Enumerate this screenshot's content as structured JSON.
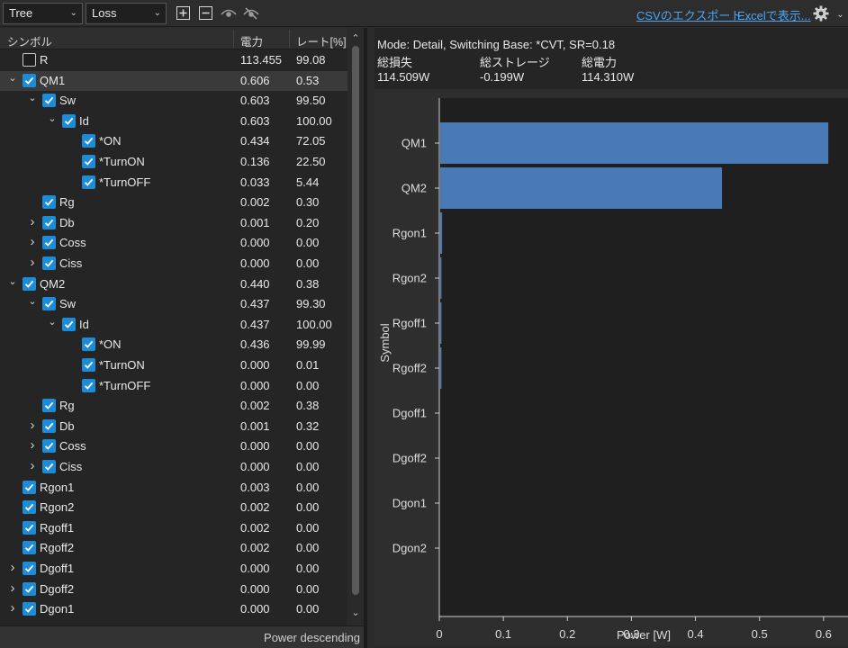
{
  "toolbar": {
    "view_combo": "Tree",
    "type_combo": "Loss",
    "csv_link": "CSVのエクスポート...",
    "excel_link": "Excelで表示..."
  },
  "table": {
    "headers": {
      "symbol": "シンボル",
      "power": "電力",
      "rate": "レート[%]"
    },
    "rows": [
      {
        "label": "R",
        "power": "113.455",
        "rate": "99.08",
        "depth": 0,
        "expander": "none",
        "checked": false,
        "selected": false
      },
      {
        "label": "QM1",
        "power": "0.606",
        "rate": "0.53",
        "depth": 0,
        "expander": "open",
        "checked": true,
        "selected": true
      },
      {
        "label": "Sw",
        "power": "0.603",
        "rate": "99.50",
        "depth": 1,
        "expander": "open",
        "checked": true,
        "selected": false
      },
      {
        "label": "Id",
        "power": "0.603",
        "rate": "100.00",
        "depth": 2,
        "expander": "open",
        "checked": true,
        "selected": false
      },
      {
        "label": "*ON",
        "power": "0.434",
        "rate": "72.05",
        "depth": 3,
        "expander": "none",
        "checked": true,
        "selected": false
      },
      {
        "label": "*TurnON",
        "power": "0.136",
        "rate": "22.50",
        "depth": 3,
        "expander": "none",
        "checked": true,
        "selected": false
      },
      {
        "label": "*TurnOFF",
        "power": "0.033",
        "rate": "5.44",
        "depth": 3,
        "expander": "none",
        "checked": true,
        "selected": false
      },
      {
        "label": "Rg",
        "power": "0.002",
        "rate": "0.30",
        "depth": 1,
        "expander": "none",
        "checked": true,
        "selected": false
      },
      {
        "label": "Db",
        "power": "0.001",
        "rate": "0.20",
        "depth": 1,
        "expander": "closed",
        "checked": true,
        "selected": false
      },
      {
        "label": "Coss",
        "power": "0.000",
        "rate": "0.00",
        "depth": 1,
        "expander": "closed",
        "checked": true,
        "selected": false
      },
      {
        "label": "Ciss",
        "power": "0.000",
        "rate": "0.00",
        "depth": 1,
        "expander": "closed",
        "checked": true,
        "selected": false
      },
      {
        "label": "QM2",
        "power": "0.440",
        "rate": "0.38",
        "depth": 0,
        "expander": "open",
        "checked": true,
        "selected": false
      },
      {
        "label": "Sw",
        "power": "0.437",
        "rate": "99.30",
        "depth": 1,
        "expander": "open",
        "checked": true,
        "selected": false
      },
      {
        "label": "Id",
        "power": "0.437",
        "rate": "100.00",
        "depth": 2,
        "expander": "open",
        "checked": true,
        "selected": false
      },
      {
        "label": "*ON",
        "power": "0.436",
        "rate": "99.99",
        "depth": 3,
        "expander": "none",
        "checked": true,
        "selected": false
      },
      {
        "label": "*TurnON",
        "power": "0.000",
        "rate": "0.01",
        "depth": 3,
        "expander": "none",
        "checked": true,
        "selected": false
      },
      {
        "label": "*TurnOFF",
        "power": "0.000",
        "rate": "0.00",
        "depth": 3,
        "expander": "none",
        "checked": true,
        "selected": false
      },
      {
        "label": "Rg",
        "power": "0.002",
        "rate": "0.38",
        "depth": 1,
        "expander": "none",
        "checked": true,
        "selected": false
      },
      {
        "label": "Db",
        "power": "0.001",
        "rate": "0.32",
        "depth": 1,
        "expander": "closed",
        "checked": true,
        "selected": false
      },
      {
        "label": "Coss",
        "power": "0.000",
        "rate": "0.00",
        "depth": 1,
        "expander": "closed",
        "checked": true,
        "selected": false
      },
      {
        "label": "Ciss",
        "power": "0.000",
        "rate": "0.00",
        "depth": 1,
        "expander": "closed",
        "checked": true,
        "selected": false
      },
      {
        "label": "Rgon1",
        "power": "0.003",
        "rate": "0.00",
        "depth": 0,
        "expander": "none",
        "checked": true,
        "selected": false
      },
      {
        "label": "Rgon2",
        "power": "0.002",
        "rate": "0.00",
        "depth": 0,
        "expander": "none",
        "checked": true,
        "selected": false
      },
      {
        "label": "Rgoff1",
        "power": "0.002",
        "rate": "0.00",
        "depth": 0,
        "expander": "none",
        "checked": true,
        "selected": false
      },
      {
        "label": "Rgoff2",
        "power": "0.002",
        "rate": "0.00",
        "depth": 0,
        "expander": "none",
        "checked": true,
        "selected": false
      },
      {
        "label": "Dgoff1",
        "power": "0.000",
        "rate": "0.00",
        "depth": 0,
        "expander": "closed",
        "checked": true,
        "selected": false
      },
      {
        "label": "Dgoff2",
        "power": "0.000",
        "rate": "0.00",
        "depth": 0,
        "expander": "closed",
        "checked": true,
        "selected": false
      },
      {
        "label": "Dgon1",
        "power": "0.000",
        "rate": "0.00",
        "depth": 0,
        "expander": "closed",
        "checked": true,
        "selected": false
      }
    ]
  },
  "status": {
    "sort_text": "Power descending"
  },
  "summary": {
    "mode": "Mode: Detail, Switching Base: *CVT, SR=0.18",
    "total_loss_label": "総損失",
    "total_storage_label": "総ストレージ",
    "total_power_label": "総電力",
    "total_loss_value": "114.509W",
    "total_storage_value": "-0.199W",
    "total_power_value": "114.310W"
  },
  "chart_data": {
    "type": "bar",
    "orientation": "horizontal",
    "categories": [
      "QM1",
      "QM2",
      "Rgon1",
      "Rgon2",
      "Rgoff1",
      "Rgoff2",
      "Dgoff1",
      "Dgoff2",
      "Dgon1",
      "Dgon2"
    ],
    "values": [
      0.606,
      0.44,
      0.003,
      0.002,
      0.002,
      0.002,
      0.0,
      0.0,
      0.0,
      0.0
    ],
    "xlabel": "Power [W]",
    "ylabel": "Symbol",
    "x_ticks": [
      "0",
      "0.1",
      "0.2",
      "0.3",
      "0.4",
      "0.5",
      "0.6",
      "0."
    ],
    "xlim": [
      0,
      0.7
    ],
    "bar_color": "#4a7ab5",
    "grid": false
  },
  "colors": {
    "accent": "#1d8cd8",
    "link": "#4ea3f0"
  }
}
